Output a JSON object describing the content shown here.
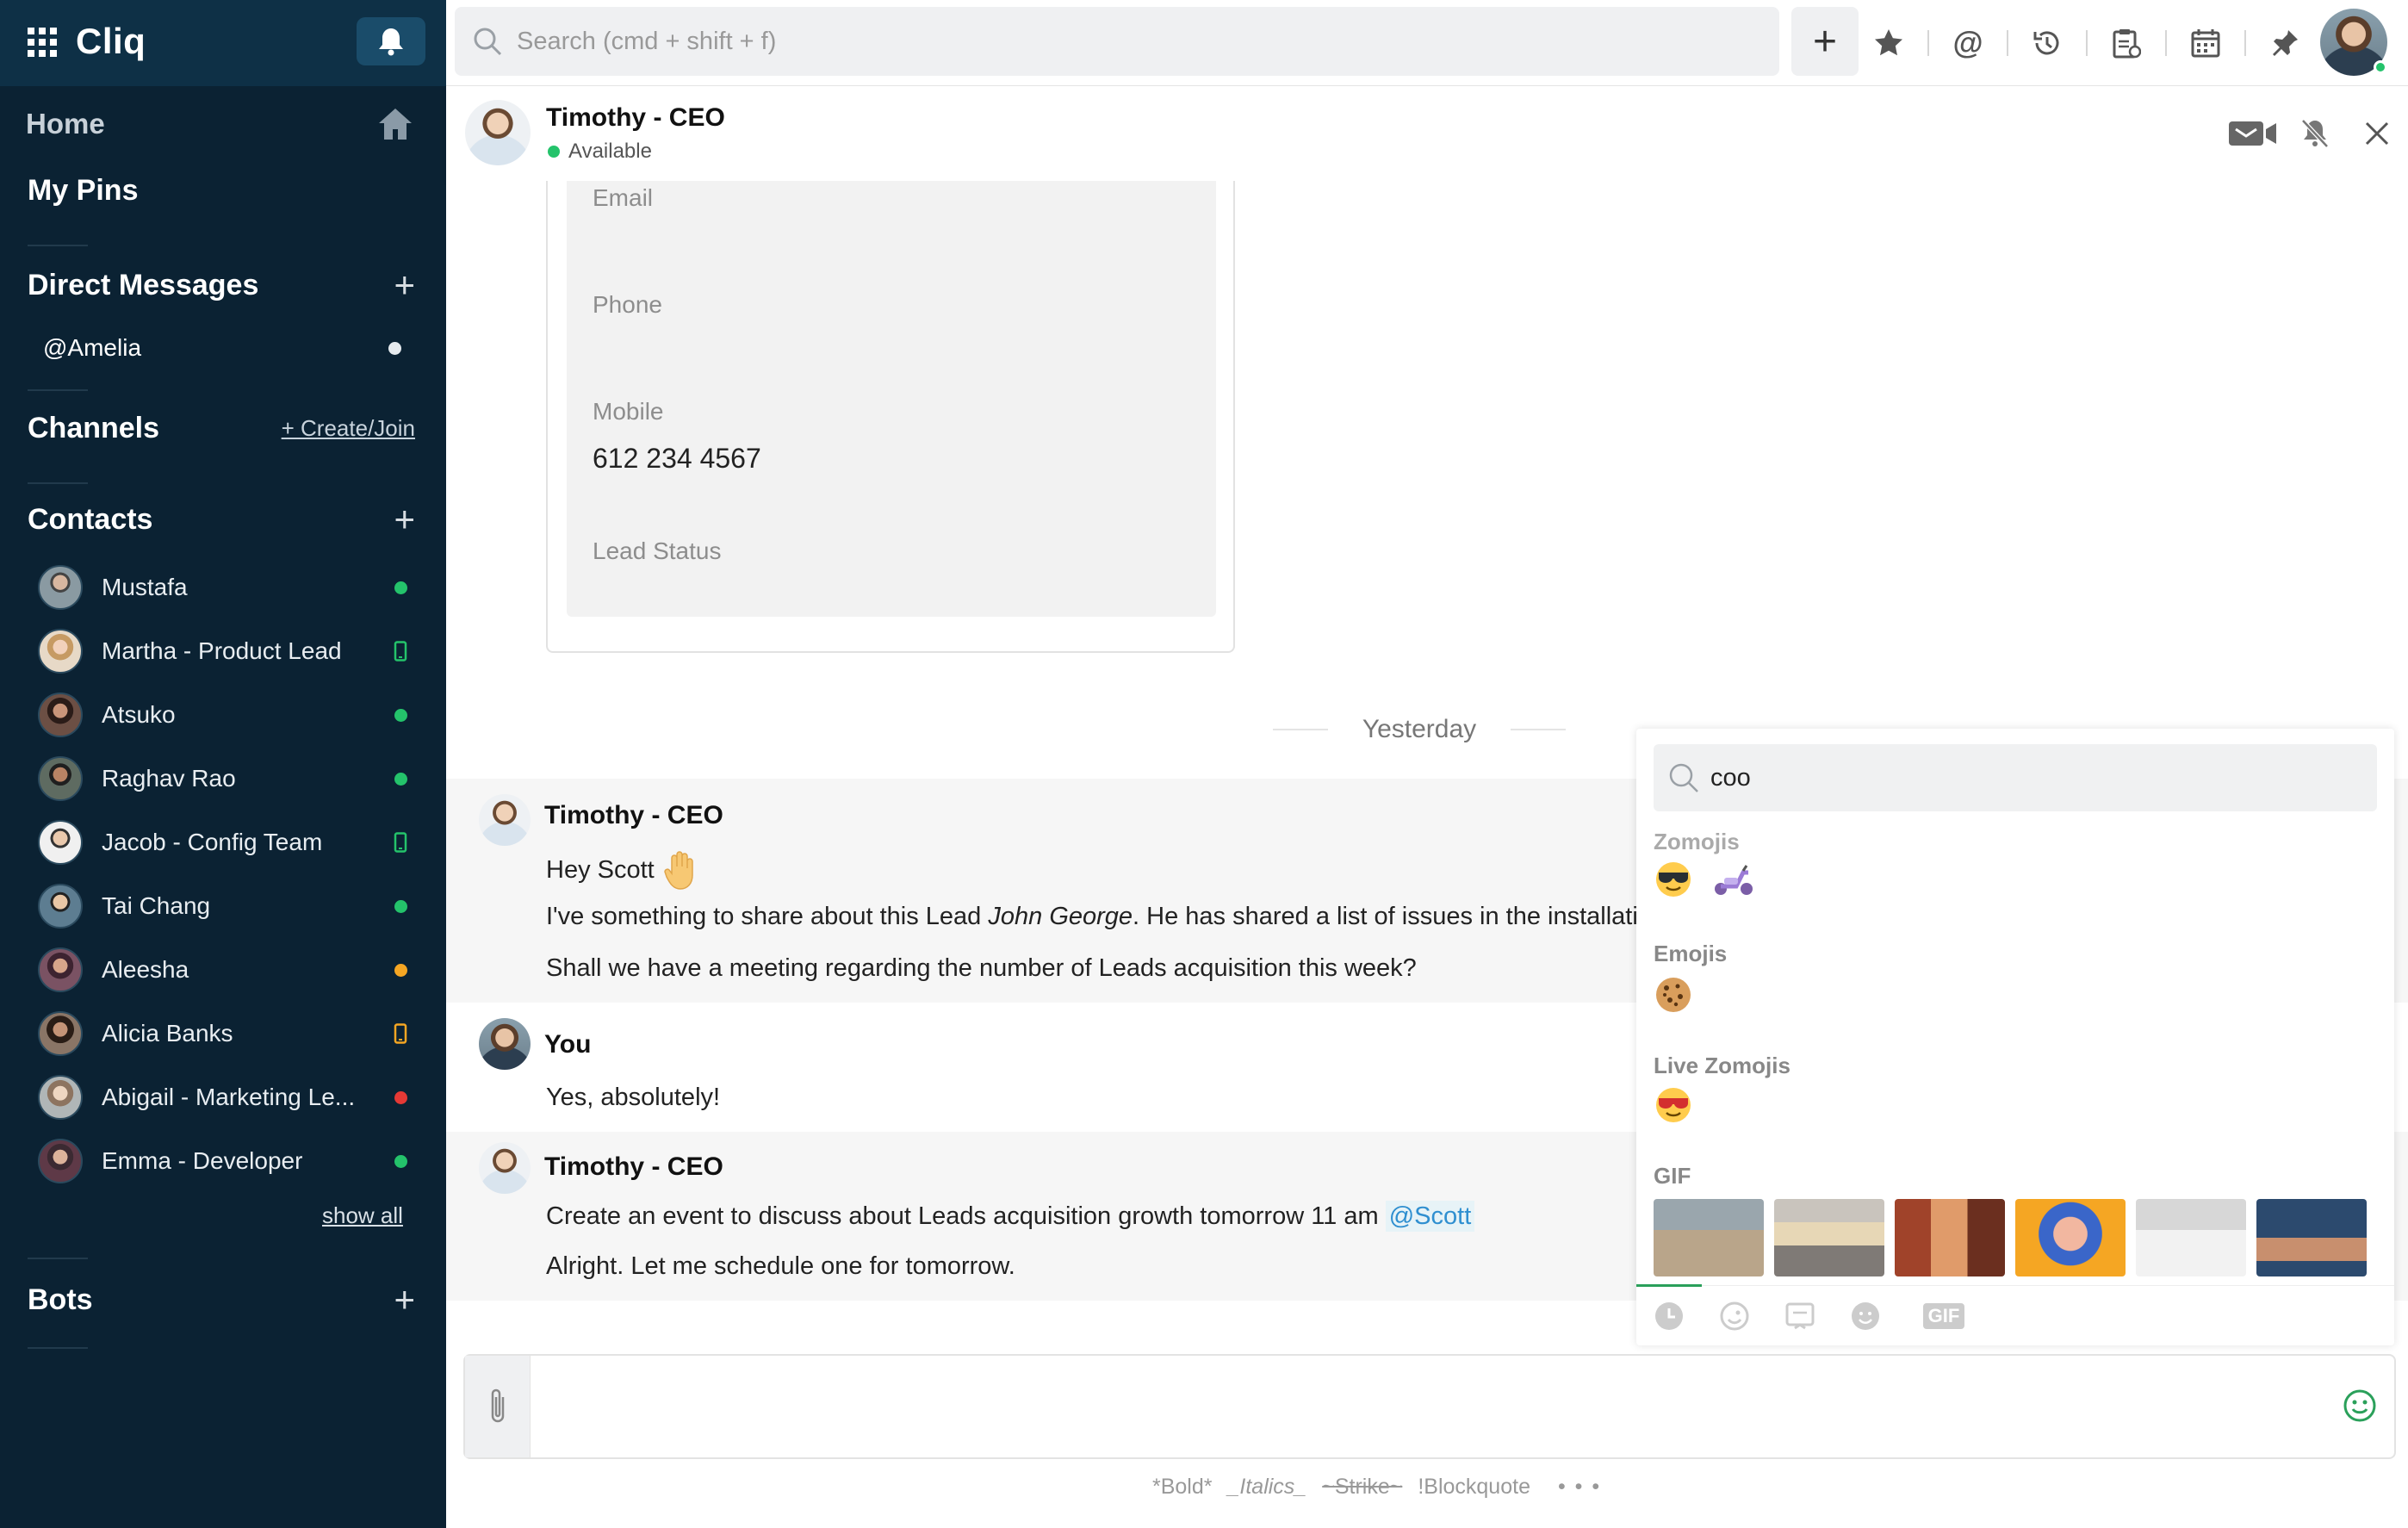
{
  "app": {
    "name": "Cliq"
  },
  "sidebar": {
    "home_label": "Home",
    "pins_label": "My Pins",
    "direct_messages": {
      "title": "Direct Messages",
      "items": [
        {
          "label": "@Amelia"
        }
      ]
    },
    "channels": {
      "title": "Channels",
      "action_label": "+ Create/Join"
    },
    "contacts": {
      "title": "Contacts",
      "items": [
        {
          "name": "Mustafa",
          "status": "online"
        },
        {
          "name": "Martha -  Product Lead",
          "status": "mobile"
        },
        {
          "name": "Atsuko",
          "status": "online"
        },
        {
          "name": "Raghav Rao",
          "status": "online"
        },
        {
          "name": "Jacob - Config Team",
          "status": "mobile"
        },
        {
          "name": "Tai Chang",
          "status": "online"
        },
        {
          "name": "Aleesha",
          "status": "away"
        },
        {
          "name": "Alicia Banks",
          "status": "mobile-away"
        },
        {
          "name": "Abigail - Marketing Le...",
          "status": "busy"
        },
        {
          "name": "Emma - Developer",
          "status": "online"
        }
      ],
      "show_all_label": "show all"
    },
    "bots": {
      "title": "Bots"
    }
  },
  "topbar": {
    "search_placeholder": "Search (cmd + shift + f)",
    "icons": [
      "star-icon",
      "mention-icon",
      "history-icon",
      "clipboard-icon",
      "calendar-icon",
      "pin-icon"
    ]
  },
  "chat_header": {
    "name": "Timothy - CEO",
    "status": "Available"
  },
  "lead_card": {
    "fields": [
      {
        "label": "Email",
        "value": ""
      },
      {
        "label": "Phone",
        "value": ""
      },
      {
        "label": "Mobile",
        "value": "612  234 4567"
      },
      {
        "label": "Lead Status",
        "value": ""
      }
    ]
  },
  "messages": {
    "date_separator": "Yesterday",
    "groups": [
      {
        "author": "Timothy - CEO",
        "lines": [
          "Hey Scott",
          "I've something to share about this Lead",
          "John George",
          ". He has shared a list of issues in the installatic",
          "Shall we have a meeting regarding the number of Leads acquisition this week?"
        ]
      },
      {
        "author": "You",
        "lines": [
          "Yes, absolutely!"
        ]
      },
      {
        "author": "Timothy - CEO",
        "lines": [
          "Create an event to discuss about Leads acquisition growth tomorrow 11 am",
          "@Scott",
          "Alright. Let me schedule one for tomorrow."
        ]
      }
    ]
  },
  "composer": {
    "format_hints": {
      "bold": "*Bold*",
      "italics": "_Italics_",
      "strike": "~Strike~",
      "blockquote": "!Blockquote",
      "more": "• • •"
    }
  },
  "emoji_picker": {
    "search_value": "coo",
    "sections": {
      "zomojis": "Zomojis",
      "emojis": "Emojis",
      "live_zomojis": "Live Zomojis",
      "gif": "GIF"
    },
    "tabs": [
      "recent-icon",
      "zomoji-icon",
      "sticker-icon",
      "emoji-icon",
      "gif-tab-icon"
    ],
    "gif_tab_label": "GIF"
  },
  "colors": {
    "sidebar_bg": "#0b2233",
    "online": "#24c36b",
    "away": "#f5a623",
    "busy": "#e53935",
    "mention": "#2f8fd0"
  }
}
